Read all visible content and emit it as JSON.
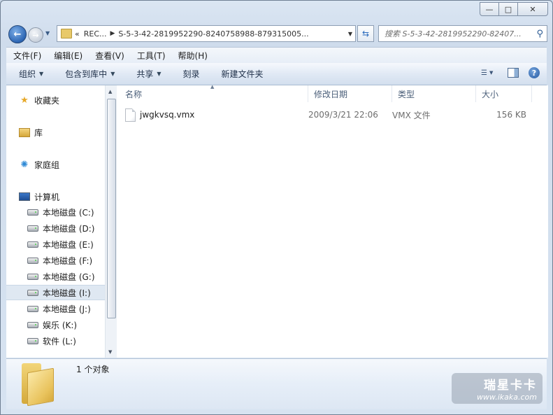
{
  "window": {
    "caption_buttons": [
      "minimize",
      "maximize",
      "close"
    ]
  },
  "address_bar": {
    "prefix": "«",
    "crumb_1": "REC...",
    "crumb_2": "S-5-3-42-2819952290-8240758988-879315005...",
    "search_placeholder": "搜索 S-5-3-42-2819952290-82407..."
  },
  "menu": [
    "文件(F)",
    "编辑(E)",
    "查看(V)",
    "工具(T)",
    "帮助(H)"
  ],
  "toolbar": {
    "organize": "组织",
    "include_in_library": "包含到库中",
    "share": "共享",
    "burn": "刻录",
    "new_folder": "新建文件夹"
  },
  "nav": {
    "favorites": "收藏夹",
    "libraries": "库",
    "homegroup": "家庭组",
    "computer": "计算机",
    "drives": [
      {
        "label": "本地磁盘 (C:)",
        "selected": false,
        "system": true
      },
      {
        "label": "本地磁盘 (D:)",
        "selected": false
      },
      {
        "label": "本地磁盘 (E:)",
        "selected": false
      },
      {
        "label": "本地磁盘 (F:)",
        "selected": false
      },
      {
        "label": "本地磁盘 (G:)",
        "selected": false
      },
      {
        "label": "本地磁盘 (I:)",
        "selected": true
      },
      {
        "label": "本地磁盘 (J:)",
        "selected": false
      },
      {
        "label": "娱乐 (K:)",
        "selected": false
      },
      {
        "label": "软件 (L:)",
        "selected": false
      }
    ]
  },
  "columns": [
    "名称",
    "修改日期",
    "类型",
    "大小"
  ],
  "files": [
    {
      "name": "jwgkvsq.vmx",
      "modified": "2009/3/21 22:06",
      "type": "VMX 文件",
      "size": "156 KB"
    }
  ],
  "details": {
    "count": "1 个对象"
  },
  "watermark": {
    "line1": "瑞星卡卡",
    "line2": "www.ikaka.com"
  }
}
